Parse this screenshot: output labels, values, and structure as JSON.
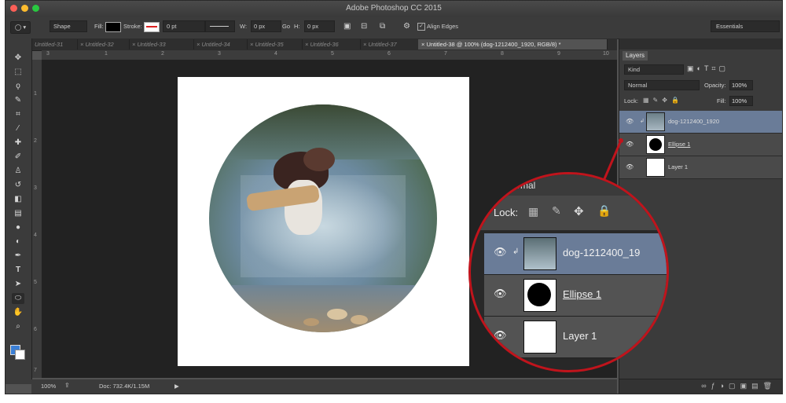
{
  "window": {
    "title": "Adobe Photoshop CC 2015"
  },
  "options_bar": {
    "mode": "Shape",
    "fill_label": "Fill:",
    "stroke_label": "Stroke:",
    "stroke_size": "0 pt",
    "w_label": "W:",
    "w_value": "0 px",
    "h_label": "H:",
    "h_value": "0 px",
    "go_label": "Go",
    "align_edges": "Align Edges",
    "workspace": "Essentials"
  },
  "tabs": [
    {
      "label": "Untitled-31"
    },
    {
      "label": "× Untitled-32"
    },
    {
      "label": "× Untitled-33"
    },
    {
      "label": "× Untitled-34"
    },
    {
      "label": "× Untitled-35"
    },
    {
      "label": "× Untitled-36"
    },
    {
      "label": "× Untitled-37"
    },
    {
      "label": "× Untitled-38 @ 100% (dog-1212400_1920, RGB/8) *"
    }
  ],
  "ruler_h": [
    "3",
    "1",
    "2",
    "3",
    "4",
    "5",
    "6",
    "7",
    "8",
    "9",
    "10"
  ],
  "ruler_v": [
    "1",
    "2",
    "3",
    "4",
    "5",
    "6",
    "7"
  ],
  "status": {
    "zoom": "100%",
    "doc": "Doc: 732.4K/1.15M"
  },
  "layers_panel": {
    "tab": "Layers",
    "kind": "Kind",
    "blend": "Normal",
    "opacity_label": "Opacity:",
    "opacity": "100%",
    "lock_label": "Lock:",
    "fill_label": "Fill:",
    "fill": "100%",
    "layers": [
      {
        "name": "dog-1212400_1920",
        "selected": true
      },
      {
        "name": "Ellipse 1",
        "selected": false
      },
      {
        "name": "Layer 1",
        "selected": false
      }
    ]
  },
  "zoom_callout": {
    "header": "rmal",
    "lock_label": "Lock:",
    "layers": [
      {
        "name": "dog-1212400_19",
        "selected": true
      },
      {
        "name": "Ellipse 1",
        "selected": false
      },
      {
        "name": "Layer 1",
        "selected": false
      }
    ],
    "accent": "#c0141c"
  },
  "tools": [
    "move-icon",
    "marquee-icon",
    "lasso-icon",
    "quick-select-icon",
    "crop-icon",
    "eyedropper-icon",
    "healing-icon",
    "brush-icon",
    "stamp-icon",
    "history-brush-icon",
    "eraser-icon",
    "gradient-icon",
    "blur-icon",
    "dodge-icon",
    "pen-icon",
    "type-icon",
    "path-select-icon",
    "shape-icon",
    "hand-icon",
    "zoom-icon"
  ]
}
